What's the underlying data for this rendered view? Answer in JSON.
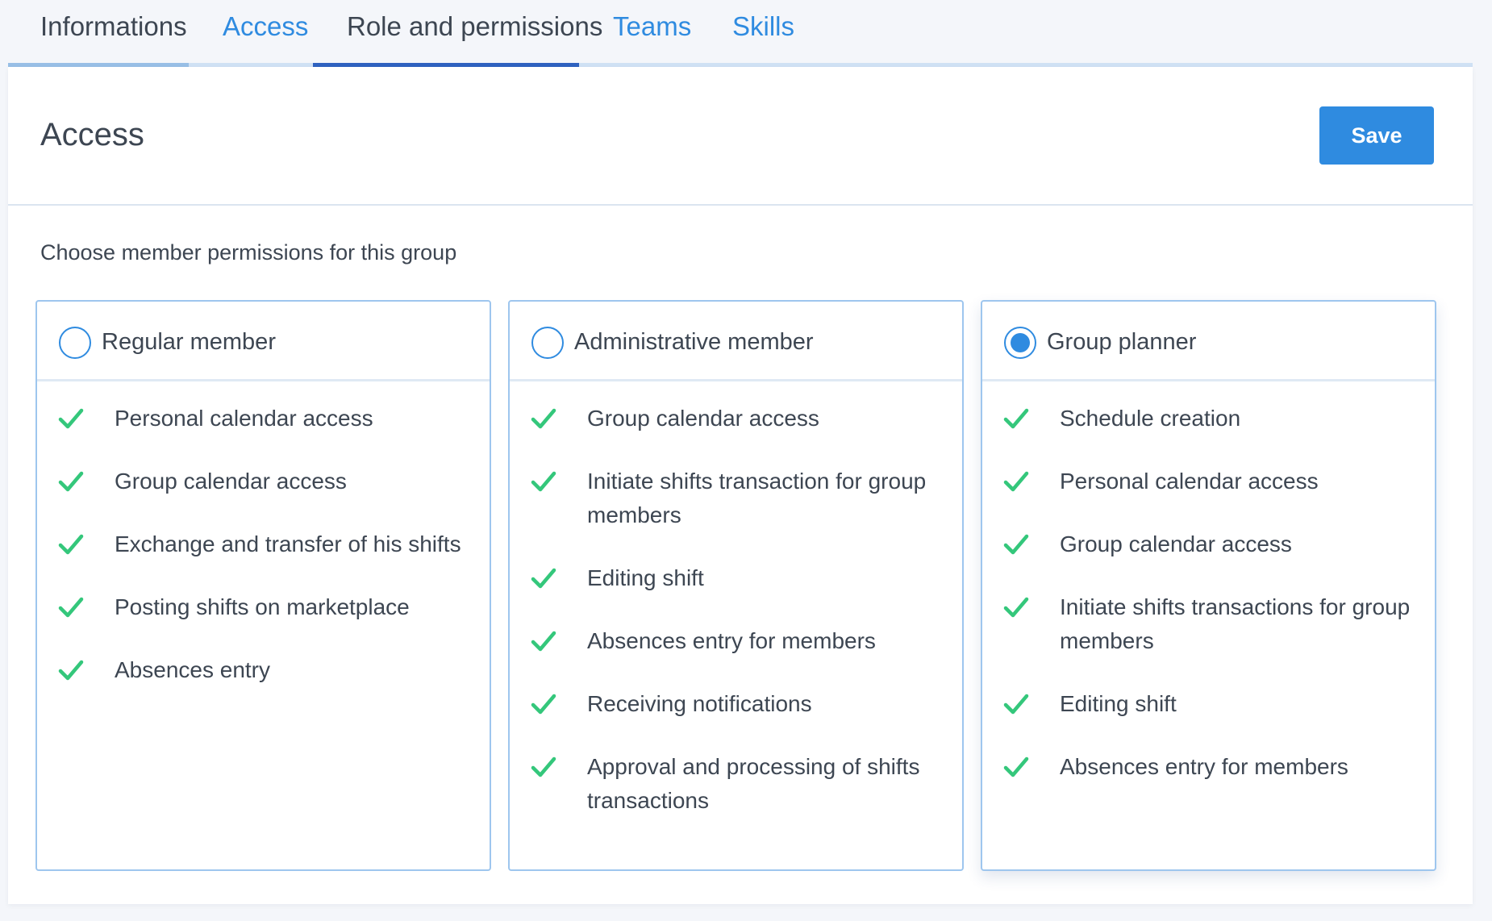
{
  "tabs": [
    {
      "label": "Informations",
      "style": "plain"
    },
    {
      "label": "Access",
      "style": "link"
    },
    {
      "label": "Role and permissions",
      "style": "plain",
      "active": true
    },
    {
      "label": "Teams",
      "style": "link"
    },
    {
      "label": "Skills",
      "style": "link"
    }
  ],
  "header": {
    "title": "Access",
    "save_label": "Save"
  },
  "subtitle": "Choose member permissions for this group",
  "options": [
    {
      "title": "Regular member",
      "selected": false,
      "permissions": [
        "Personal calendar access",
        "Group calendar access",
        "Exchange and transfer of his shifts",
        "Posting shifts on marketplace",
        "Absences entry"
      ]
    },
    {
      "title": "Administrative member",
      "selected": false,
      "permissions": [
        "Group calendar access",
        "Initiate shifts transaction for group members",
        "Editing shift",
        "Absences entry for members",
        "Receiving notifications",
        "Approval and processing of shifts transactions"
      ]
    },
    {
      "title": "Group planner",
      "selected": true,
      "permissions": [
        "Schedule creation",
        "Personal calendar access",
        "Group calendar access",
        "Initiate shifts transactions for group members",
        "Editing shift",
        "Absences entry for members"
      ]
    }
  ],
  "colors": {
    "accent": "#2f8be0",
    "check": "#34c77b",
    "text": "#3d4652",
    "active_tab_underline": "#2f62c0",
    "inactive_tab_underline": "#cfe1f4",
    "first_tab_underline": "#98bfe6"
  },
  "icons": {
    "check": "check-icon",
    "radio": "radio-button"
  }
}
